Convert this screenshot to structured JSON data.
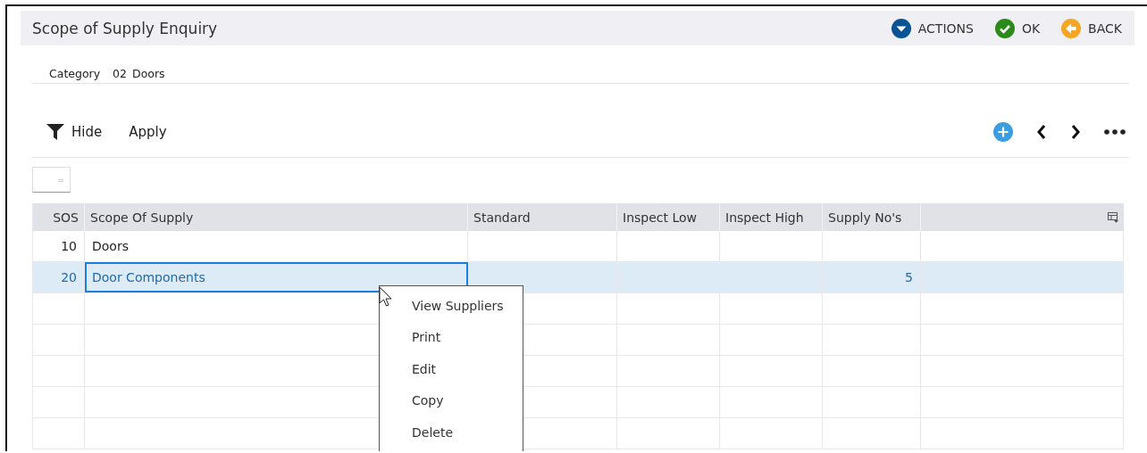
{
  "header": {
    "title": "Scope of Supply Enquiry",
    "actions": [
      {
        "kind": "actions",
        "label": "ACTIONS"
      },
      {
        "kind": "ok",
        "label": "OK"
      },
      {
        "kind": "back",
        "label": "BACK"
      }
    ]
  },
  "category": {
    "label": "Category",
    "code": "02",
    "name": "Doors"
  },
  "toolbar": {
    "filter_label": "Hide",
    "apply_label": "Apply"
  },
  "filter_field": {
    "operator": "="
  },
  "table": {
    "columns": [
      "SOS",
      "Scope Of Supply",
      "Standard",
      "Inspect Low",
      "Inspect High",
      "Supply No's"
    ],
    "rows": [
      {
        "sos": "10",
        "scope_of_supply": "Doors",
        "selected": false
      },
      {
        "sos": "20",
        "scope_of_supply": "Door Components",
        "supply_nos": "5",
        "selected": true
      }
    ]
  },
  "context_menu": {
    "items": [
      "View Suppliers",
      "Print",
      "Edit",
      "Copy",
      "Delete"
    ]
  }
}
